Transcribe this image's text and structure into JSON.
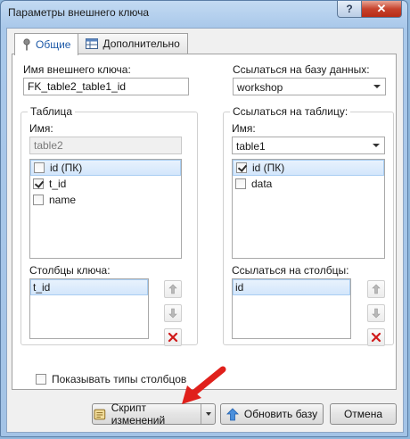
{
  "window": {
    "title": "Параметры внешнего ключа",
    "help_label": "?",
    "close_label": "✕"
  },
  "tabs": [
    {
      "label": "Общие",
      "icon": "pin-icon",
      "active": true
    },
    {
      "label": "Дополнительно",
      "icon": "table-icon",
      "active": false
    }
  ],
  "fk_name": {
    "label": "Имя внешнего ключа:",
    "value": "FK_table2_table1_id"
  },
  "ref_db": {
    "label": "Ссылаться на базу данных:",
    "value": "workshop"
  },
  "table_group": {
    "title": "Таблица",
    "name_label": "Имя:",
    "name_value": "table2",
    "columns": [
      {
        "name": "id (ПК)",
        "checked": false,
        "selected": true
      },
      {
        "name": "t_id",
        "checked": true,
        "selected": false
      },
      {
        "name": "name",
        "checked": false,
        "selected": false
      }
    ],
    "key_columns_label": "Столбцы ключа:",
    "key_columns": [
      "t_id"
    ]
  },
  "ref_table_group": {
    "title": "Ссылаться на таблицу:",
    "name_label": "Имя:",
    "name_value": "table1",
    "columns": [
      {
        "name": "id (ПК)",
        "checked": true,
        "selected": true
      },
      {
        "name": "data",
        "checked": false,
        "selected": false
      }
    ],
    "ref_columns_label": "Ссылаться на столбцы:",
    "ref_columns": [
      "id"
    ]
  },
  "show_types": {
    "label": "Показывать типы столбцов",
    "checked": false
  },
  "buttons": {
    "script": "Скрипт изменений",
    "update": "Обновить базу",
    "cancel": "Отмена"
  },
  "colors": {
    "accent_red": "#e0201b",
    "selection": "#d3e6fb",
    "title_bar": "#a9c8ea",
    "close_red": "#c7432d"
  }
}
